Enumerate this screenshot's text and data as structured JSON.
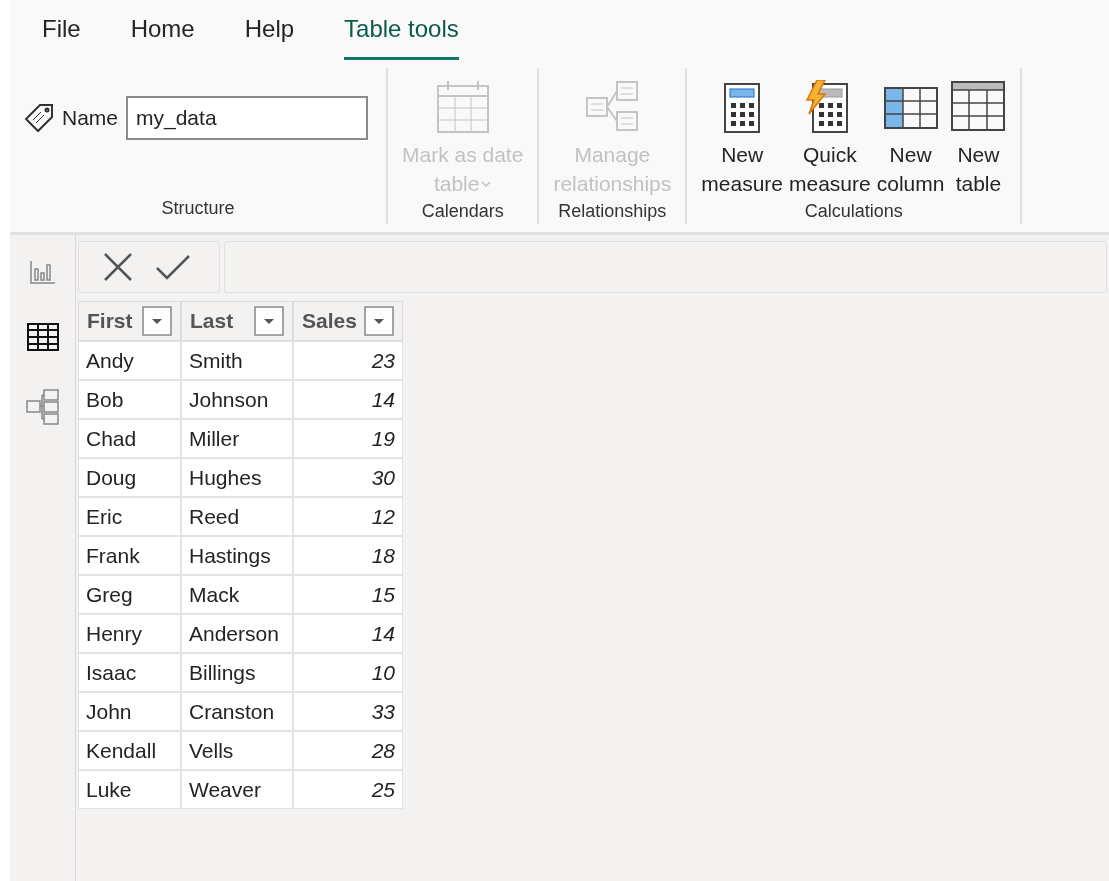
{
  "menu_tabs": [
    {
      "label": "File",
      "selected": false
    },
    {
      "label": "Home",
      "selected": false
    },
    {
      "label": "Help",
      "selected": false
    },
    {
      "label": "Table tools",
      "selected": true
    }
  ],
  "ribbon": {
    "groups": [
      {
        "label": "Structure",
        "kind": "field",
        "field": {
          "label": "Name",
          "value": "my_data"
        }
      },
      {
        "label": "Calendars",
        "kind": "buttons",
        "buttons": [
          {
            "kind": "calendar",
            "lines": [
              "Mark as date",
              "table"
            ],
            "dropdown": true,
            "disabled": true
          }
        ]
      },
      {
        "label": "Relationships",
        "kind": "buttons",
        "buttons": [
          {
            "kind": "relationships",
            "lines": [
              "Manage",
              "relationships"
            ],
            "dropdown": false,
            "disabled": true
          }
        ]
      },
      {
        "label": "Calculations",
        "kind": "buttons",
        "buttons": [
          {
            "kind": "measure",
            "lines": [
              "New",
              "measure"
            ],
            "dropdown": false,
            "disabled": false
          },
          {
            "kind": "quick_measure",
            "lines": [
              "Quick",
              "measure"
            ],
            "dropdown": false,
            "disabled": false
          },
          {
            "kind": "column",
            "lines": [
              "New",
              "column"
            ],
            "dropdown": false,
            "disabled": false
          },
          {
            "kind": "table",
            "lines": [
              "New",
              "table"
            ],
            "dropdown": false,
            "disabled": false
          }
        ]
      }
    ]
  },
  "nav_rail": [
    {
      "kind": "report",
      "selected": false
    },
    {
      "kind": "table",
      "selected": true
    },
    {
      "kind": "model",
      "selected": false
    }
  ],
  "table": {
    "columns": [
      {
        "label": "First",
        "kind": "text"
      },
      {
        "label": "Last",
        "kind": "text"
      },
      {
        "label": "Sales",
        "kind": "number"
      }
    ],
    "rows": [
      [
        "Andy",
        "Smith",
        "23"
      ],
      [
        "Bob",
        "Johnson",
        "14"
      ],
      [
        "Chad",
        "Miller",
        "19"
      ],
      [
        "Doug",
        "Hughes",
        "30"
      ],
      [
        "Eric",
        "Reed",
        "12"
      ],
      [
        "Frank",
        "Hastings",
        "18"
      ],
      [
        "Greg",
        "Mack",
        "15"
      ],
      [
        "Henry",
        "Anderson",
        "14"
      ],
      [
        "Isaac",
        "Billings",
        "10"
      ],
      [
        "John",
        "Cranston",
        "33"
      ],
      [
        "Kendall",
        "Vells",
        "28"
      ],
      [
        "Luke",
        "Weaver",
        "25"
      ]
    ]
  }
}
